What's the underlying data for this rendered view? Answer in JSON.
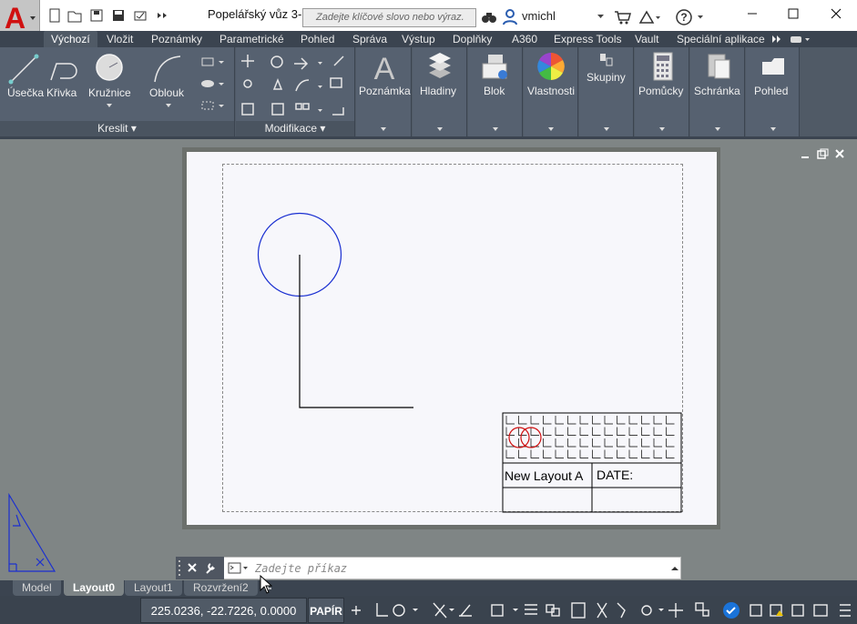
{
  "window": {
    "doc_title": "Popelářský vůz 3-...",
    "search_placeholder": "Zadejte klíčové slovo nebo výraz.",
    "user_name": "vmichl"
  },
  "ribbon_tabs": [
    "Výchozí",
    "Vložit",
    "Poznámky",
    "Parametrické",
    "Pohled",
    "Správa",
    "Výstup",
    "Doplňky",
    "A360",
    "Express Tools",
    "Vault",
    "Speciální aplikace"
  ],
  "draw_panel": {
    "label": "Kreslit",
    "tools": [
      "Úsečka",
      "Křivka",
      "Kružnice",
      "Oblouk"
    ]
  },
  "modify_panel": {
    "label": "Modifikace"
  },
  "large_panels": [
    "Poznámka",
    "Hladiny",
    "Blok",
    "Vlastnosti",
    "Skupiny",
    "Pomůcky",
    "Schránka",
    "Pohled"
  ],
  "title_block": {
    "name": "New Layout A",
    "date_label": "DATE:"
  },
  "command_line": {
    "placeholder": "Zadejte příkaz"
  },
  "layout_tabs": [
    "Model",
    "Layout0",
    "Layout1",
    "Rozvržení2"
  ],
  "active_layout_tab": "Layout0",
  "status": {
    "coordinates": "225.0236, -22.7226, 0.0000",
    "space": "PAPÍR"
  },
  "colors": {
    "ribbon_bg": "#505a66",
    "tab_bar_bg": "#3b4450",
    "drawing_blue": "#1a2fd1",
    "logo_red": "#d01010",
    "sheet_bg": "#f7f7fb"
  }
}
